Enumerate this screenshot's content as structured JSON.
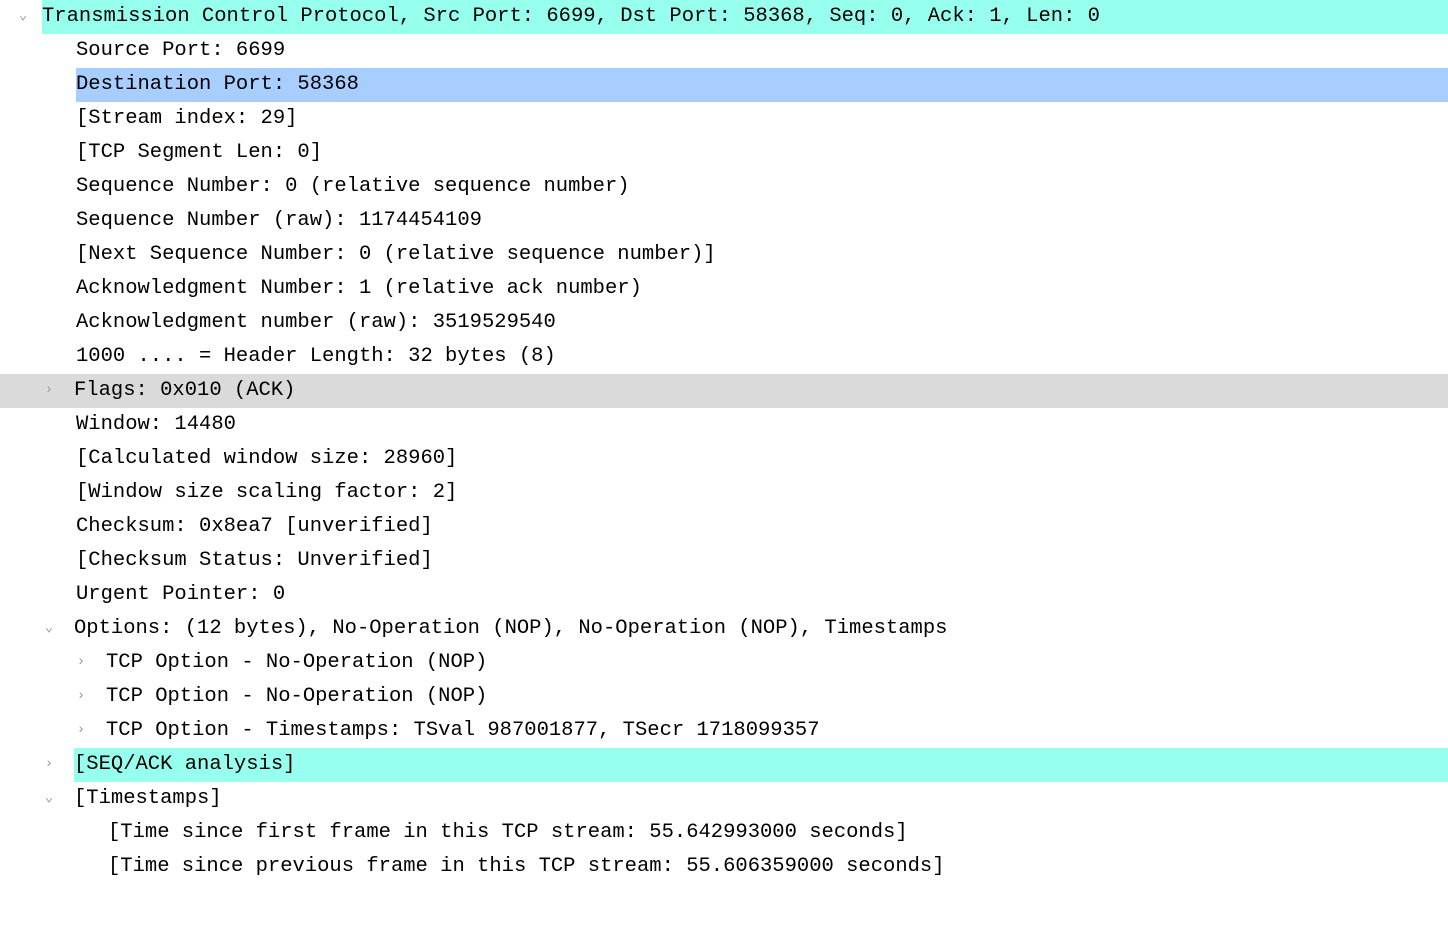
{
  "tcp": {
    "header": "Transmission Control Protocol, Src Port: 6699, Dst Port: 58368, Seq: 0, Ack: 1, Len: 0",
    "srcPort": "Source Port: 6699",
    "dstPort": "Destination Port: 58368",
    "streamIndex": "[Stream index: 29]",
    "segLen": "[TCP Segment Len: 0]",
    "seqNum": "Sequence Number: 0    (relative sequence number)",
    "seqNumRaw": "Sequence Number (raw): 1174454109",
    "nextSeq": "[Next Sequence Number: 0    (relative sequence number)]",
    "ackNum": "Acknowledgment Number: 1    (relative ack number)",
    "ackNumRaw": "Acknowledgment number (raw): 3519529540",
    "hdrLen": "1000 .... = Header Length: 32 bytes (8)",
    "flags": "Flags: 0x010 (ACK)",
    "window": "Window: 14480",
    "calcWin": "[Calculated window size: 28960]",
    "winScale": "[Window size scaling factor: 2]",
    "checksum": "Checksum: 0x8ea7 [unverified]",
    "checksumStatus": "[Checksum Status: Unverified]",
    "urgent": "Urgent Pointer: 0",
    "options": "Options: (12 bytes), No-Operation (NOP), No-Operation (NOP), Timestamps",
    "optNop1": "TCP Option - No-Operation (NOP)",
    "optNop2": "TCP Option - No-Operation (NOP)",
    "optTs": "TCP Option - Timestamps: TSval 987001877, TSecr 1718099357",
    "seqAck": "[SEQ/ACK analysis]",
    "timestamps": "[Timestamps]",
    "tsFirst": "[Time since first frame in this TCP stream: 55.642993000 seconds]",
    "tsPrev": "[Time since previous frame in this TCP stream: 55.606359000 seconds]"
  },
  "glyphs": {
    "expanded": "⌄",
    "collapsed": "›"
  }
}
